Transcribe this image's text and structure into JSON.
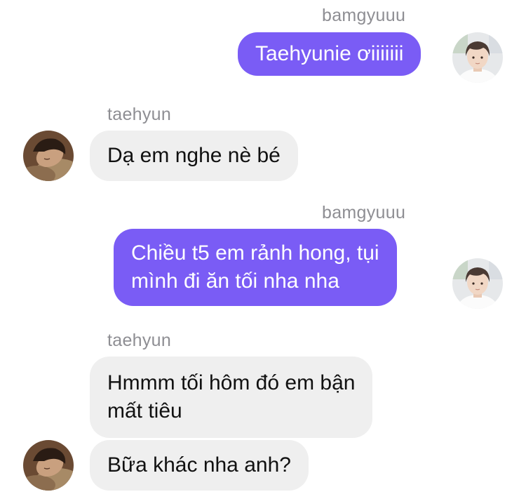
{
  "colors": {
    "outgoing_bubble": "#7a5cf5",
    "incoming_bubble": "#efefef",
    "sender_name": "#8e8e93"
  },
  "messages": [
    {
      "sender": "bamgyuuu",
      "direction": "outgoing",
      "lines": [
        "Taehyunie ơiiiiiii"
      ]
    },
    {
      "sender": "taehyun",
      "direction": "incoming",
      "lines": [
        "Dạ em nghe nè bé"
      ]
    },
    {
      "sender": "bamgyuuu",
      "direction": "outgoing",
      "lines": [
        "Chiều t5 em rảnh hong, tụi",
        "mình đi ăn tối nha nha"
      ]
    },
    {
      "sender": "taehyun",
      "direction": "incoming",
      "lines": [
        "Hmmm tối hôm đó em bận",
        "mất tiêu"
      ]
    },
    {
      "sender": "taehyun",
      "direction": "incoming",
      "lines": [
        "Bữa khác nha anh?"
      ]
    }
  ],
  "avatars": {
    "bamgyuuu": "avatar-photo-bamgyuuu",
    "taehyun": "avatar-photo-taehyun"
  }
}
